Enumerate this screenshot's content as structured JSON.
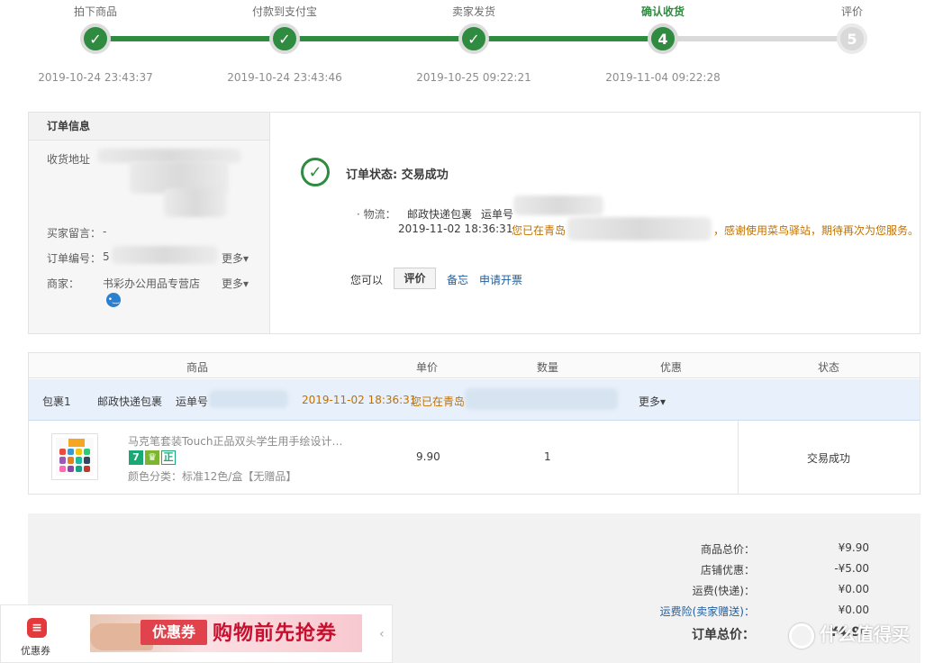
{
  "steps": [
    {
      "name": "拍下商品",
      "icon": "✓",
      "time": "2019-10-24 23:43:37"
    },
    {
      "name": "付款到支付宝",
      "icon": "✓",
      "time": "2019-10-24 23:43:46"
    },
    {
      "name": "卖家发货",
      "icon": "✓",
      "time": "2019-10-25 09:22:21"
    },
    {
      "name": "确认收货",
      "icon": "4",
      "time": "2019-11-04 09:22:28"
    },
    {
      "name": "评价",
      "icon": "5",
      "time": ""
    }
  ],
  "order_info": {
    "title": "订单信息",
    "address_label": "收货地址",
    "buyer_message_label": "买家留言：",
    "buyer_message_value": "-",
    "order_no_label": "订单编号：",
    "order_no_prefix": "5",
    "seller_label": "商家：",
    "seller_name": "书彩办公用品专营店",
    "more_label": "更多"
  },
  "status": {
    "check_icon": "✓",
    "text": "订单状态: 交易成功",
    "logistics_label": "· 物流：",
    "logistics_company": "邮政快递包裹",
    "waybill_label": "运单号",
    "event_time": "2019-11-02 18:36:31",
    "event_msg_start": "您已在青岛",
    "event_msg_end": "，感谢使用菜鸟驿站，期待再次为您服务。",
    "actions_label": "您可以",
    "review_button": "评价",
    "memo_link": "备忘",
    "invoice_link": "申请开票"
  },
  "product_table": {
    "headers": [
      "商品",
      "单价",
      "数量",
      "优惠",
      "状态"
    ],
    "package": {
      "name": "包裹1",
      "company": "邮政快递包裹",
      "waybill_label": "运单号",
      "time": "2019-11-02 18:36:31",
      "msg": "您已在青岛",
      "more": "更多"
    },
    "item": {
      "title": "马克笔套装Touch正品双头学生用手绘设计…",
      "badges": [
        "7",
        "♛",
        "正"
      ],
      "sku": "颜色分类：标准12色/盒【无赠品】",
      "price": "9.90",
      "qty": "1",
      "status": "交易成功"
    }
  },
  "totals": {
    "rows": [
      {
        "label": "商品总价：",
        "value": "¥9.90"
      },
      {
        "label": "店铺优惠：",
        "value": "-¥5.00"
      },
      {
        "label": "运费(快递)：",
        "value": "¥0.00"
      },
      {
        "label": "运费险(卖家赠送)：",
        "value": "¥0.00"
      },
      {
        "label": "订单总价：",
        "value": "¥4.90"
      }
    ]
  },
  "coupon_bar": {
    "label": "优惠券",
    "banner_tag": "优惠券",
    "banner_text": "购物前先抢券"
  },
  "watermark": "什么值得买"
}
